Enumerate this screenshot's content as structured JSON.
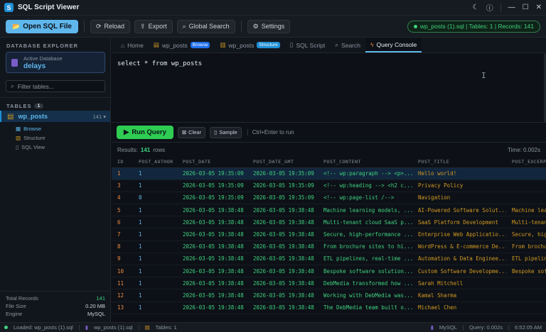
{
  "app": {
    "title": "SQL Script Viewer"
  },
  "titlebar": {
    "theme_icon": "moon-icon",
    "info_icon": "info-icon",
    "minimize": "—",
    "maximize": "☐",
    "close": "✕"
  },
  "toolbar": {
    "open_label": "Open SQL File",
    "reload_label": "Reload",
    "export_label": "Export",
    "global_search_label": "Global Search",
    "settings_label": "Settings",
    "status": "wp_posts (1).sql | Tables: 1 | Records: 141"
  },
  "sidebar": {
    "heading": "DATABASE EXPLORER",
    "active_db_label": "Active Database",
    "active_db_name": "delays",
    "filter_placeholder": "Filter tables...",
    "tables_heading": "TABLES",
    "tables_count": "1",
    "table": {
      "name": "wp_posts",
      "count": "141"
    },
    "sub_items": [
      "Browse",
      "Structure",
      "SQL View"
    ],
    "stats": [
      {
        "label": "Total Records",
        "value": "141"
      },
      {
        "label": "File Size",
        "value": "0.20 MB"
      },
      {
        "label": "Engine",
        "value": "MySQL"
      }
    ]
  },
  "tabs": [
    {
      "label": "Home"
    },
    {
      "label": "wp_posts",
      "badge": "Browse"
    },
    {
      "label": "wp_posts",
      "badge": "Structure"
    },
    {
      "label": "SQL Script"
    },
    {
      "label": "Search"
    },
    {
      "label": "Query Console"
    }
  ],
  "editor": {
    "query": "select * from wp_posts"
  },
  "runbar": {
    "run_label": "Run Query",
    "clear_label": "Clear",
    "sample_label": "Sample",
    "hint": "Ctrl+Enter to run"
  },
  "results": {
    "label": "Results:",
    "count": "141",
    "unit": "rows",
    "time": "Time: 0.002s"
  },
  "grid": {
    "columns": [
      "ID",
      "POST_AUTHOR",
      "POST_DATE",
      "POST_DATE_GMT",
      "POST_CONTENT",
      "POST_TITLE",
      "POST_EXCERPT"
    ],
    "rows": [
      [
        "1",
        "1",
        "2026-03-05 19:35:09",
        "2026-03-05 19:35:09",
        "<!-- wp:paragraph --> <p>...",
        "Hello world!",
        ""
      ],
      [
        "3",
        "1",
        "2026-03-05 19:35:09",
        "2026-03-05 19:35:09",
        "<!-- wp:heading --> <h2 c...",
        "Privacy Policy",
        ""
      ],
      [
        "4",
        "0",
        "2026-03-05 19:35:09",
        "2026-03-05 19:35:09",
        "<!-- wp:page-list /-->",
        "Navigation",
        ""
      ],
      [
        "5",
        "1",
        "2026-03-05 19:38:48",
        "2026-03-05 19:38:48",
        "Machine learning models, ...",
        "AI-Powered Software Solut...",
        "Machine lea"
      ],
      [
        "6",
        "1",
        "2026-03-05 19:38:48",
        "2026-03-05 19:38:48",
        "Multi-tenant cloud SaaS p...",
        "SaaS Platform Development",
        "Multi-tenan"
      ],
      [
        "7",
        "1",
        "2026-03-05 19:38:48",
        "2026-03-05 19:38:48",
        "Secure, high-performance ...",
        "Enterprise Web Applicatio...",
        "Secure, hig"
      ],
      [
        "8",
        "1",
        "2026-03-05 19:38:48",
        "2026-03-05 19:38:48",
        "From brochure sites to hi...",
        "WordPress & E-commerce De...",
        "From brochu"
      ],
      [
        "9",
        "1",
        "2026-03-05 19:38:48",
        "2026-03-05 19:38:48",
        "ETL pipelines, real-time ...",
        "Automation & Data Enginee...",
        "ETL pipelin"
      ],
      [
        "10",
        "1",
        "2026-03-05 19:38:48",
        "2026-03-05 19:38:48",
        "Bespoke software solution...",
        "Custom Software Developme...",
        "Bespoke sof"
      ],
      [
        "11",
        "1",
        "2026-03-05 19:38:48",
        "2026-03-05 19:38:48",
        "DebMedia transformed how ...",
        "Sarah Mitchell",
        ""
      ],
      [
        "12",
        "1",
        "2026-03-05 19:38:48",
        "2026-03-05 19:38:48",
        "Working with DebMedia was...",
        "Kamal Sharma",
        ""
      ],
      [
        "13",
        "1",
        "2026-03-05 19:38:48",
        "2026-03-05 19:38:48",
        "The DebMedia team built o...",
        "Michael Chen",
        ""
      ]
    ]
  },
  "statusbar": {
    "loaded": "Loaded: wp_posts (1).sql",
    "file": "wp_posts (1).sql",
    "tables": "Tables: 1",
    "engine": "MySQL",
    "query_time": "Query: 0.002s",
    "clock": "6:52:05 AM"
  }
}
